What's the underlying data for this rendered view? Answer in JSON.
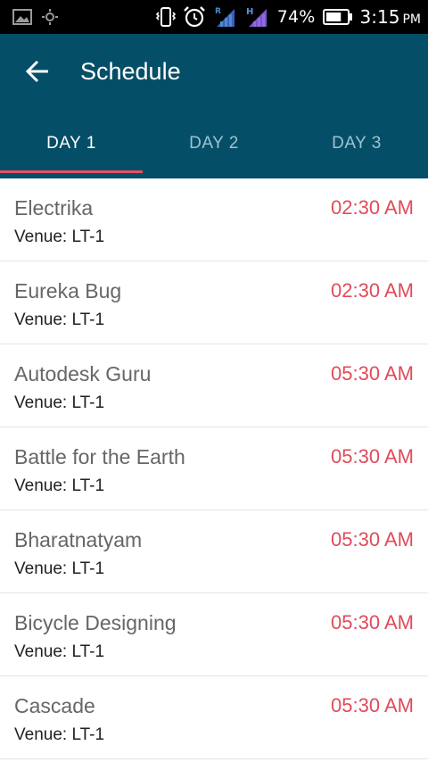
{
  "status_bar": {
    "battery_percent": "74%",
    "time": "3:15",
    "ampm": "PM",
    "icons": [
      "image-icon",
      "brightness-icon",
      "vibrate-icon",
      "alarm-icon",
      "signal-r-icon",
      "signal-h-icon",
      "battery-icon"
    ],
    "battery_level": 0.74
  },
  "toolbar": {
    "title": "Schedule"
  },
  "tabs": [
    {
      "label": "DAY 1",
      "active": true
    },
    {
      "label": "DAY 2",
      "active": false
    },
    {
      "label": "DAY 3",
      "active": false
    }
  ],
  "events": [
    {
      "title": "Electrika",
      "venue": "Venue: LT-1",
      "time": "02:30 AM"
    },
    {
      "title": "Eureka Bug",
      "venue": "Venue: LT-1",
      "time": "02:30 AM"
    },
    {
      "title": "Autodesk Guru",
      "venue": "Venue: LT-1",
      "time": "05:30 AM"
    },
    {
      "title": "Battle for the Earth",
      "venue": "Venue: LT-1",
      "time": "05:30 AM"
    },
    {
      "title": "Bharatnatyam",
      "venue": "Venue: LT-1",
      "time": "05:30 AM"
    },
    {
      "title": "Bicycle Designing",
      "venue": "Venue: LT-1",
      "time": "05:30 AM"
    },
    {
      "title": "Cascade",
      "venue": "Venue: LT-1",
      "time": "05:30 AM"
    }
  ],
  "colors": {
    "app_bar": "#054E67",
    "accent": "#E8505F",
    "time_text": "#E04B5A"
  }
}
